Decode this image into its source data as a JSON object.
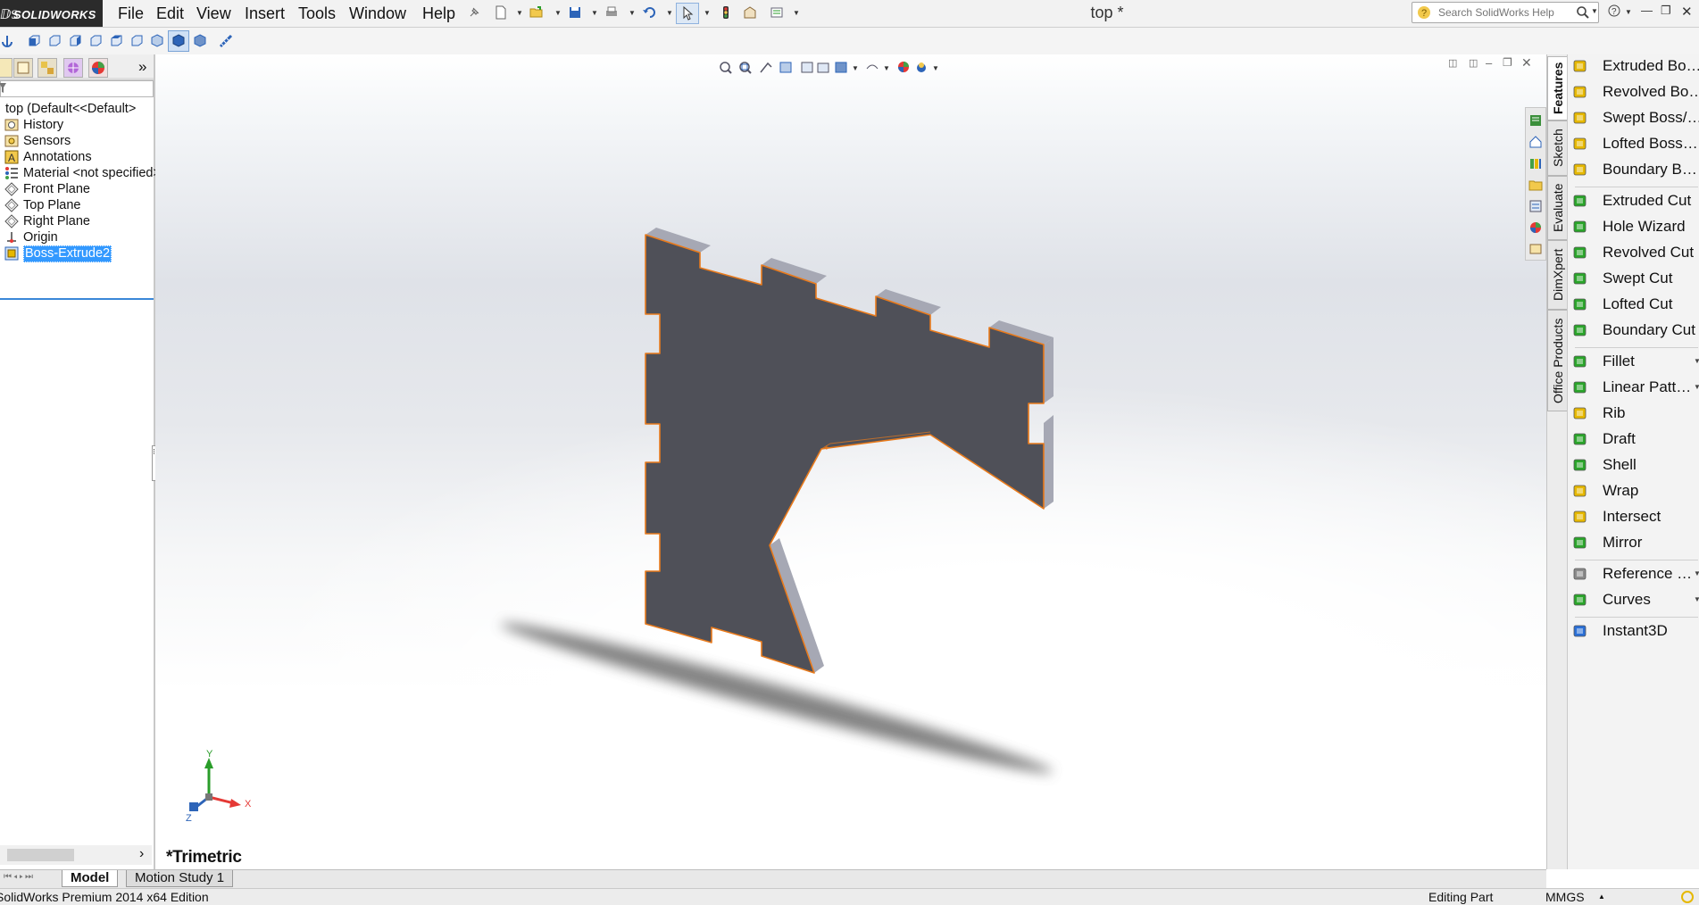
{
  "app": {
    "logo_ds": "ⅅS",
    "logo_text": "SOLIDWORKS",
    "document_title": "top *"
  },
  "menu": [
    "File",
    "Edit",
    "View",
    "Insert",
    "Tools",
    "Window",
    "Help"
  ],
  "search": {
    "placeholder": "Search SolidWorks Help"
  },
  "tree": {
    "root": "top  (Default<<Default>",
    "items": [
      {
        "label": "History",
        "icon": "history-icon"
      },
      {
        "label": "Sensors",
        "icon": "sensors-icon"
      },
      {
        "label": "Annotations",
        "icon": "annotations-icon"
      },
      {
        "label": "Material <not specified>",
        "icon": "material-icon"
      },
      {
        "label": "Front Plane",
        "icon": "plane-icon"
      },
      {
        "label": "Top Plane",
        "icon": "plane-icon"
      },
      {
        "label": "Right Plane",
        "icon": "plane-icon"
      },
      {
        "label": "Origin",
        "icon": "origin-icon"
      },
      {
        "label": "Boss-Extrude2",
        "icon": "extrude-feature-icon"
      }
    ],
    "expand_label": "»"
  },
  "viewport": {
    "orientation_label": "*Trimetric",
    "triad_x": "X",
    "triad_y": "Y",
    "triad_z": "Z"
  },
  "bottom_tabs": [
    "Model",
    "Motion Study 1"
  ],
  "status": {
    "edition": "SolidWorks Premium 2014 x64 Edition",
    "mode": "Editing Part",
    "units": "MMGS"
  },
  "command_tabs": [
    "Features",
    "Sketch",
    "Evaluate",
    "DimXpert",
    "Office Products"
  ],
  "commands": [
    {
      "label": "Extruded Boss/Base",
      "color": "#e6b800"
    },
    {
      "label": "Revolved Boss/Base",
      "color": "#e6b800"
    },
    {
      "label": "Swept Boss/Base",
      "color": "#e6b800"
    },
    {
      "label": "Lofted Boss/Base",
      "color": "#e6b800"
    },
    {
      "label": "Boundary Boss/Base",
      "color": "#e6b800"
    },
    {
      "label": "Extruded Cut",
      "color": "#2aa52a"
    },
    {
      "label": "Hole Wizard",
      "color": "#2aa52a"
    },
    {
      "label": "Revolved Cut",
      "color": "#2aa52a"
    },
    {
      "label": "Swept Cut",
      "color": "#2aa52a"
    },
    {
      "label": "Lofted Cut",
      "color": "#2aa52a"
    },
    {
      "label": "Boundary Cut",
      "color": "#2aa52a"
    },
    {
      "label": "Fillet",
      "color": "#2aa52a"
    },
    {
      "label": "Linear Pattern",
      "color": "#2aa52a"
    },
    {
      "label": "Rib",
      "color": "#e6b800"
    },
    {
      "label": "Draft",
      "color": "#2aa52a"
    },
    {
      "label": "Shell",
      "color": "#2aa52a"
    },
    {
      "label": "Wrap",
      "color": "#e6b800"
    },
    {
      "label": "Intersect",
      "color": "#e6b800"
    },
    {
      "label": "Mirror",
      "color": "#2aa52a"
    },
    {
      "label": "Reference Geometry",
      "color": "#8a8a8a"
    },
    {
      "label": "Curves",
      "color": "#2aa52a"
    },
    {
      "label": "Instant3D",
      "color": "#2a6fd6"
    }
  ],
  "colors": {
    "part_face": "#4f5058",
    "part_edge": "#e87a1c",
    "part_side": "#a6a8b4",
    "selection": "#3399ff"
  }
}
